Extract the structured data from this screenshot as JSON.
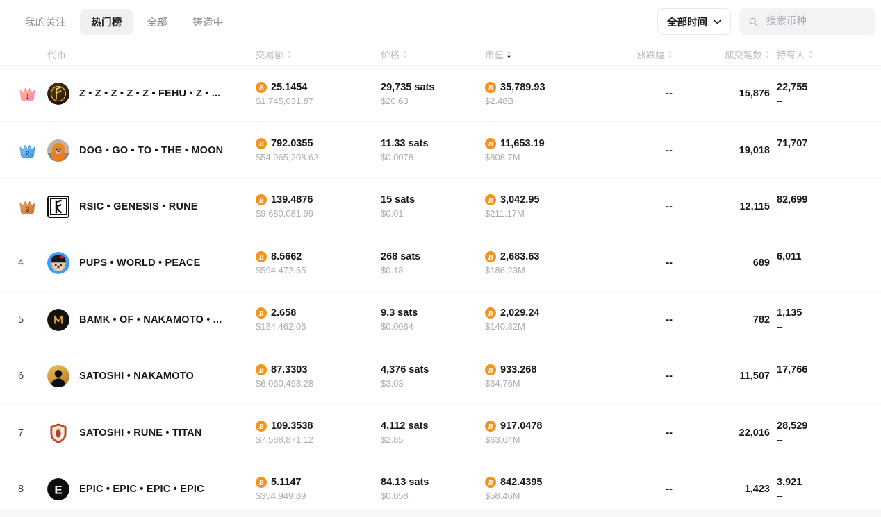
{
  "nav": {
    "tabs": [
      {
        "label": "我的关注",
        "active": false
      },
      {
        "label": "热门榜",
        "active": true
      },
      {
        "label": "全部",
        "active": false
      },
      {
        "label": "铸造中",
        "active": false
      }
    ]
  },
  "controls": {
    "time_filter": {
      "label": "全部时间",
      "icon": "chevron-down-icon"
    },
    "search": {
      "placeholder": "搜索币种",
      "value": "",
      "icon": "search-icon"
    }
  },
  "table": {
    "columns": [
      {
        "key": "rank",
        "label": "",
        "sortable": false,
        "sorted": "none"
      },
      {
        "key": "token",
        "label": "代币",
        "sortable": false,
        "sorted": "none"
      },
      {
        "key": "volume",
        "label": "交易额",
        "sortable": true,
        "sorted": "none"
      },
      {
        "key": "price",
        "label": "价格",
        "sortable": true,
        "sorted": "none"
      },
      {
        "key": "marketcap",
        "label": "市值",
        "sortable": true,
        "sorted": "desc"
      },
      {
        "key": "change",
        "label": "涨跌幅",
        "sortable": true,
        "sorted": "none"
      },
      {
        "key": "txcount",
        "label": "成交笔数",
        "sortable": true,
        "sorted": "none"
      },
      {
        "key": "holders",
        "label": "持有人",
        "sortable": true,
        "sorted": "none"
      }
    ],
    "rows": [
      {
        "rank": "1",
        "rank_badge": "crown-gold-icon",
        "avatar": "fehu-rune-coin-avatar",
        "name": "Z • Z • Z • Z • Z • FEHU • Z • ...",
        "volume_btc": "25.1454",
        "volume_usd": "$1,745,031.87",
        "price_sats": "29,735 sats",
        "price_usd": "$20.63",
        "mcap_btc": "35,789.93",
        "mcap_usd": "$2.48B",
        "change": "--",
        "txcount": "15,876",
        "holders": "22,755",
        "holders_sub": "--"
      },
      {
        "rank": "2",
        "rank_badge": "crown-silver-icon",
        "avatar": "dog-photo-avatar",
        "name": "DOG • GO • TO • THE • MOON",
        "volume_btc": "792.0355",
        "volume_usd": "$54,965,208.62",
        "price_sats": "11.33 sats",
        "price_usd": "$0.0078",
        "mcap_btc": "11,653.19",
        "mcap_usd": "$808.7M",
        "change": "--",
        "txcount": "19,018",
        "holders": "71,707",
        "holders_sub": "--"
      },
      {
        "rank": "3",
        "rank_badge": "crown-bronze-icon",
        "avatar": "rsic-glyph-avatar",
        "name": "RSIC • GENESIS • RUNE",
        "volume_btc": "139.4876",
        "volume_usd": "$9,680,081.99",
        "price_sats": "15 sats",
        "price_usd": "$0.01",
        "mcap_btc": "3,042.95",
        "mcap_usd": "$211.17M",
        "change": "--",
        "txcount": "12,115",
        "holders": "82,699",
        "holders_sub": "--"
      },
      {
        "rank": "4",
        "rank_badge": "",
        "avatar": "pups-bear-avatar",
        "name": "PUPS • WORLD • PEACE",
        "volume_btc": "8.5662",
        "volume_usd": "$594,472.55",
        "price_sats": "268 sats",
        "price_usd": "$0.18",
        "mcap_btc": "2,683.63",
        "mcap_usd": "$186.23M",
        "change": "--",
        "txcount": "689",
        "holders": "6,011",
        "holders_sub": "--"
      },
      {
        "rank": "5",
        "rank_badge": "",
        "avatar": "bamk-monogram-avatar",
        "name": "BAMK • OF • NAKAMOTO • ...",
        "volume_btc": "2.658",
        "volume_usd": "$184,462.06",
        "price_sats": "9.3 sats",
        "price_usd": "$0.0064",
        "mcap_btc": "2,029.24",
        "mcap_usd": "$140.82M",
        "change": "--",
        "txcount": "782",
        "holders": "1,135",
        "holders_sub": "--"
      },
      {
        "rank": "6",
        "rank_badge": "",
        "avatar": "satoshi-silhouette-avatar",
        "name": "SATOSHI • NAKAMOTO",
        "volume_btc": "87.3303",
        "volume_usd": "$6,060,498.28",
        "price_sats": "4,376 sats",
        "price_usd": "$3.03",
        "mcap_btc": "933.268",
        "mcap_usd": "$64.76M",
        "change": "--",
        "txcount": "11,507",
        "holders": "17,766",
        "holders_sub": "--"
      },
      {
        "rank": "7",
        "rank_badge": "",
        "avatar": "titan-crest-avatar",
        "name": "SATOSHI • RUNE • TITAN",
        "volume_btc": "109.3538",
        "volume_usd": "$7,588,871.12",
        "price_sats": "4,112 sats",
        "price_usd": "$2.85",
        "mcap_btc": "917.0478",
        "mcap_usd": "$63.64M",
        "change": "--",
        "txcount": "22,016",
        "holders": "28,529",
        "holders_sub": "--"
      },
      {
        "rank": "8",
        "rank_badge": "",
        "avatar": "epic-e-avatar",
        "name": "EPIC • EPIC • EPIC • EPIC",
        "volume_btc": "5.1147",
        "volume_usd": "$354,949.89",
        "price_sats": "84.13 sats",
        "price_usd": "$0.058",
        "mcap_btc": "842.4395",
        "mcap_usd": "$58.46M",
        "change": "--",
        "txcount": "1,423",
        "holders": "3,921",
        "holders_sub": "--"
      }
    ]
  },
  "theme": {
    "bitcoin_orange": "#f7931a",
    "text_primary": "#15171a",
    "text_muted": "#a9acb1",
    "header_muted": "#b9bcc1",
    "active_tab_bg": "#f0f0f1",
    "search_bg": "#f2f3f4"
  }
}
